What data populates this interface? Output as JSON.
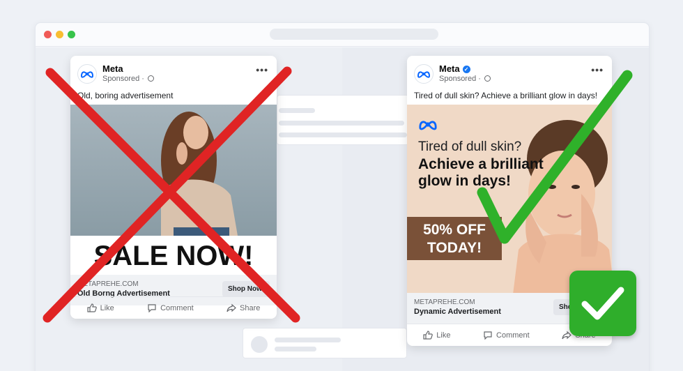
{
  "colors": {
    "x_red": "#e02424",
    "check_green": "#2fb12a",
    "meta_blue": "#0866ff",
    "off_box": "#7a5138"
  },
  "left_ad": {
    "page_name": "Meta",
    "sponsored": "Sponsored ·",
    "caption": "Old, boring advertisement",
    "banner_text": "SALE NOW!",
    "domain": "METAPREHE.COM",
    "title": "Old Borng Advertisement",
    "cta": "Shop Now",
    "icon": "red-x-icon"
  },
  "right_ad": {
    "page_name": "Meta",
    "sponsored": "Sponsored ·",
    "caption": "Tired of dull skin? Achieve a brilliant glow in days!",
    "headline_light": "Tired of dull skin?",
    "headline_bold": "Achieve a brilliant glow in days!",
    "offer_line1": "50% OFF",
    "offer_line2": "TODAY!",
    "domain": "METAPREHE.COM",
    "title": "Dynamic Advertisement",
    "cta": "Shop Now",
    "icon": "green-check-icon"
  },
  "actions": {
    "like": "Like",
    "comment": "Comment",
    "share": "Share"
  }
}
